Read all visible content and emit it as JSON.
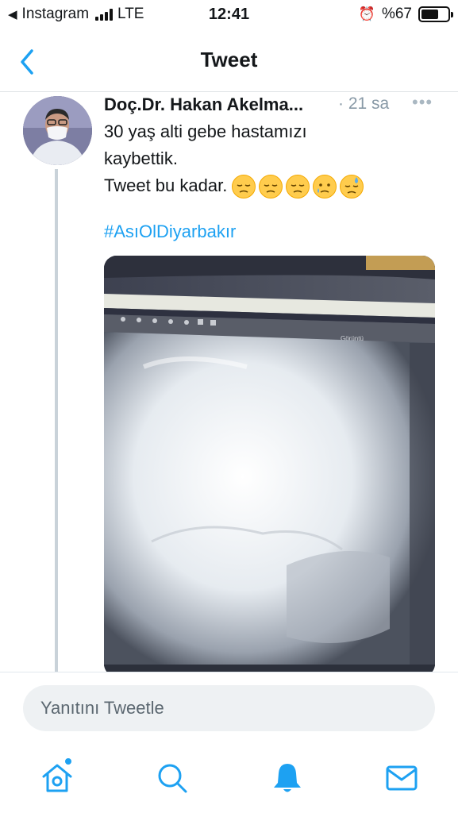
{
  "status_bar": {
    "back_app": "Instagram",
    "network": "LTE",
    "time": "12:41",
    "battery": "%67",
    "battery_level": 0.67
  },
  "header": {
    "title": "Tweet",
    "back_icon": "chevron-left-icon"
  },
  "tweet": {
    "author": "Doç.Dr. Hakan Akelma...",
    "time": "· 21 sa",
    "more_icon": "more-icon",
    "text_lines": [
      "30 yaş alti gebe hastamızı",
      "kaybettik.",
      "Tweet bu kadar."
    ],
    "emojis": [
      "pensive-emoji",
      "pensive-emoji",
      "pensive-emoji",
      "sad-tear-emoji",
      "downcast-sweat-emoji"
    ],
    "hashtag": "#AsıOlDiyarbakır",
    "media_overlay_text": "Görüntü"
  },
  "reply": {
    "placeholder": "Yanıtını Tweetle"
  },
  "tab_bar": {
    "tabs": [
      "home-icon",
      "search-icon",
      "notifications-icon",
      "messages-icon"
    ],
    "active": "notifications-icon",
    "accent": "#1da1f2"
  }
}
